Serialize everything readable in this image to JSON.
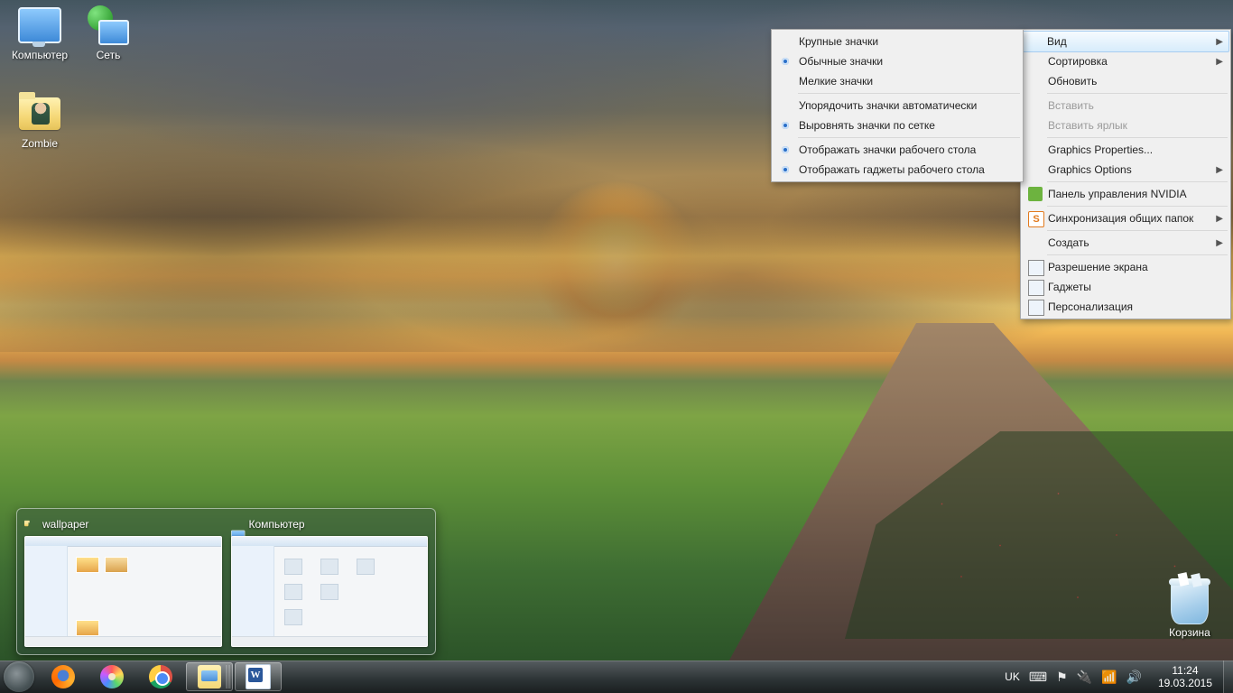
{
  "desktop_icons": {
    "computer": "Компьютер",
    "network": "Сеть",
    "zombie": "Zombie",
    "trash": "Корзина"
  },
  "context_menu": {
    "view": "Вид",
    "sort": "Сортировка",
    "refresh": "Обновить",
    "paste": "Вставить",
    "paste_shortcut": "Вставить ярлык",
    "gfx_properties": "Graphics Properties...",
    "gfx_options": "Graphics Options",
    "nvidia": "Панель управления NVIDIA",
    "sync_shared": "Синхронизация общих папок",
    "create": "Создать",
    "screen_res": "Разрешение экрана",
    "gadgets": "Гаджеты",
    "personalize": "Персонализация"
  },
  "view_submenu": {
    "large_icons": "Крупные значки",
    "medium_icons": "Обычные значки",
    "small_icons": "Мелкие значки",
    "auto_arrange": "Упорядочить значки автоматически",
    "align_to_grid": "Выровнять значки по сетке",
    "show_desktop_icons": "Отображать значки рабочего стола",
    "show_gadgets": "Отображать гаджеты  рабочего стола"
  },
  "aero_preview": {
    "wallpaper": "wallpaper",
    "computer": "Компьютер"
  },
  "tray": {
    "lang": "UK",
    "time": "11:24",
    "date": "19.03.2015"
  }
}
